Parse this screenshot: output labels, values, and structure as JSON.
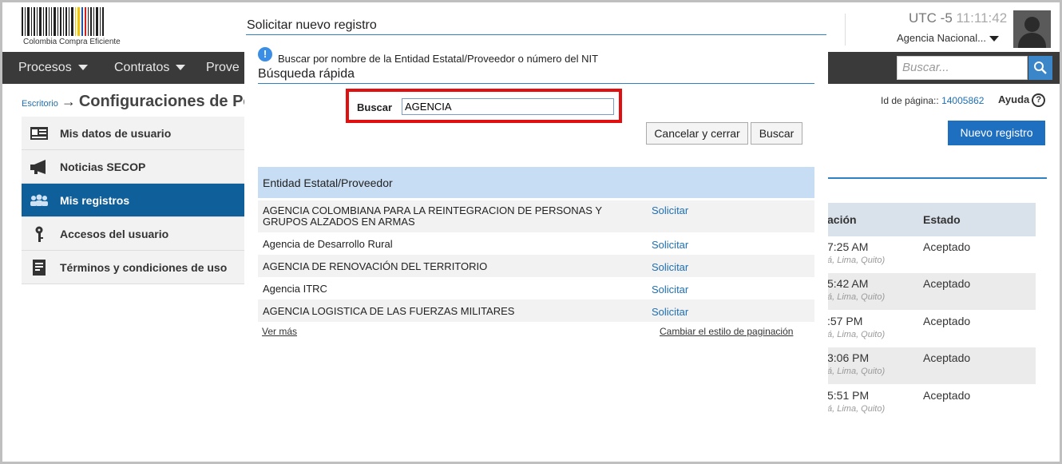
{
  "header": {
    "logo_text": "Colombia Compra Eficiente",
    "timezone": "UTC -5",
    "clock": "11:11:42",
    "agency": "Agencia Nacional...",
    "search_placeholder": "Buscar..."
  },
  "nav": {
    "items": [
      {
        "label": "Procesos"
      },
      {
        "label": "Contratos"
      },
      {
        "label": "Prove"
      }
    ]
  },
  "page": {
    "breadcrumb_home": "Escritorio",
    "arrow": "→",
    "title": "Configuraciones de Pe",
    "page_id_label": "Id de página::",
    "page_id_value": "14005862",
    "help_label": "Ayuda",
    "new_record_button": "Nuevo registro"
  },
  "sidebar": {
    "items": [
      {
        "label": "Mis datos de usuario",
        "icon": "id-card-icon",
        "active": false
      },
      {
        "label": "Noticias SECOP",
        "icon": "megaphone-icon",
        "active": false
      },
      {
        "label": "Mis registros",
        "icon": "users-icon",
        "active": true
      },
      {
        "label": "Accesos del usuario",
        "icon": "key-icon",
        "active": false
      },
      {
        "label": "Términos y condiciones de uso",
        "icon": "document-icon",
        "active": false
      }
    ]
  },
  "background_table": {
    "col_date": "ación",
    "col_status": "Estado",
    "rows": [
      {
        "time": "7:25 AM",
        "tz": "á, Lima, Quito)",
        "status": "Aceptado"
      },
      {
        "time": "5:42 AM",
        "tz": "á, Lima, Quito)",
        "status": "Aceptado"
      },
      {
        "time": ":57 PM",
        "tz": "á, Lima, Quito)",
        "status": "Aceptado"
      },
      {
        "time": "3:06 PM",
        "tz": "á, Lima, Quito)",
        "status": "Aceptado"
      },
      {
        "time": "5:51 PM",
        "tz": "á, Lima, Quito)",
        "status": "Aceptado"
      }
    ]
  },
  "modal": {
    "title": "Solicitar nuevo registro",
    "info_text": "Buscar por nombre de la Entidad Estatal/Proveedor o número del NIT",
    "section_title": "Búsqueda rápida",
    "search_label": "Buscar",
    "search_value": "AGENCIA",
    "cancel_button": "Cancelar y cerrar",
    "search_button": "Buscar",
    "results_header": "Entidad Estatal/Proveedor",
    "results": [
      {
        "name": "AGENCIA COLOMBIANA PARA LA REINTEGRACION DE PERSONAS Y GRUPOS ALZADOS EN ARMAS",
        "action": "Solicitar"
      },
      {
        "name": "Agencia de Desarrollo Rural",
        "action": "Solicitar"
      },
      {
        "name": "AGENCIA DE RENOVACIÓN DEL TERRITORIO",
        "action": "Solicitar"
      },
      {
        "name": "Agencia ITRC",
        "action": "Solicitar"
      },
      {
        "name": "AGENCIA LOGISTICA DE LAS FUERZAS MILITARES",
        "action": "Solicitar"
      }
    ],
    "more_link": "Ver más",
    "pagination_link": "Cambiar el estilo de paginación"
  },
  "colors": {
    "accent": "#2e82c4",
    "highlight": "#e01010",
    "nav_bg": "#3a3a3a",
    "sidebar_active": "#0f5f9a"
  }
}
